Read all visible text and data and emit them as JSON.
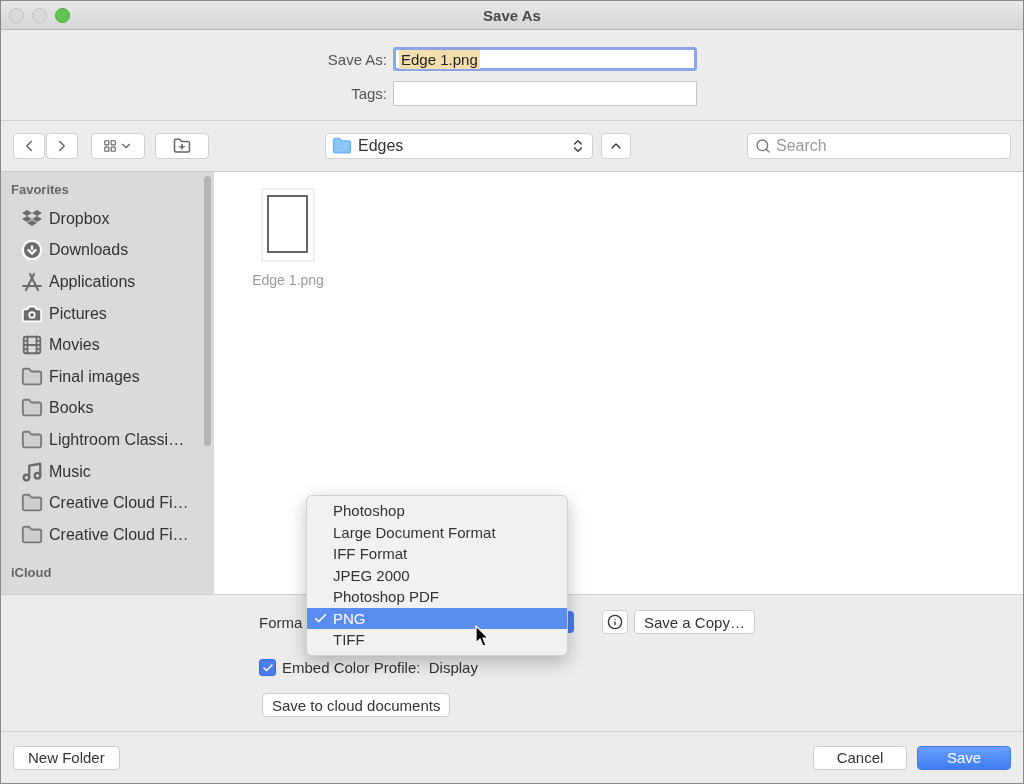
{
  "window": {
    "title": "Save As"
  },
  "save_as": {
    "label": "Save As:",
    "value": "Edge 1.png",
    "text_selected": true
  },
  "tags": {
    "label": "Tags:"
  },
  "toolbar": {
    "location": "Edges",
    "search": {
      "placeholder": "Search"
    }
  },
  "sidebar": {
    "sections": [
      {
        "heading": "Favorites",
        "items": [
          {
            "label": "Dropbox",
            "kind": "dropbox"
          },
          {
            "label": "Downloads",
            "kind": "downloads"
          },
          {
            "label": "Applications",
            "kind": "applications"
          },
          {
            "label": "Pictures",
            "kind": "pictures"
          },
          {
            "label": "Movies",
            "kind": "movies"
          },
          {
            "label": "Final images",
            "kind": "folder"
          },
          {
            "label": "Books",
            "kind": "folder"
          },
          {
            "label": "Lightroom Classi…",
            "kind": "folder"
          },
          {
            "label": "Music",
            "kind": "music"
          },
          {
            "label": "Creative Cloud Fi…",
            "kind": "folder"
          },
          {
            "label": "Creative Cloud Fi…",
            "kind": "folder"
          }
        ]
      },
      {
        "heading": "iCloud"
      }
    ]
  },
  "files": [
    {
      "name": "Edge 1.png"
    }
  ],
  "format": {
    "label": "Forma",
    "menu": [
      {
        "label": "Photoshop",
        "selected": false
      },
      {
        "label": "Large Document Format",
        "selected": false
      },
      {
        "label": "IFF Format",
        "selected": false
      },
      {
        "label": "JPEG 2000",
        "selected": false
      },
      {
        "label": "Photoshop PDF",
        "selected": false
      },
      {
        "label": "PNG",
        "selected": true
      },
      {
        "label": "TIFF",
        "selected": false
      }
    ]
  },
  "save_copy": "Save a Copy…",
  "embed_profile": {
    "label": "Embed Color Profile:  Display",
    "checked": true
  },
  "cloud_button": "Save to cloud documents",
  "footer": {
    "new_folder": "New Folder",
    "cancel": "Cancel",
    "save": "Save"
  }
}
